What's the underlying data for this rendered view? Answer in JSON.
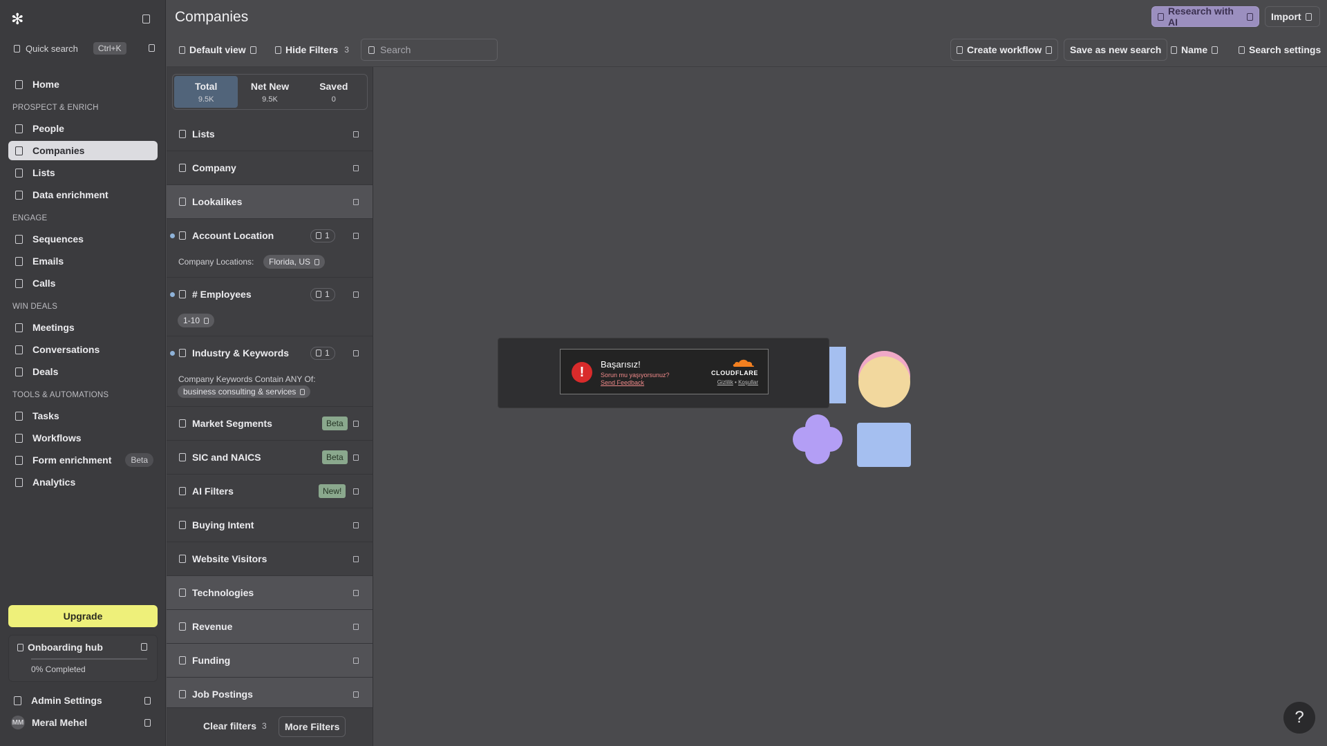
{
  "app": {
    "logo": "✻"
  },
  "sidebar": {
    "quick_search": {
      "label": "Quick search",
      "shortcut": "Ctrl+K"
    },
    "home": "Home",
    "sections": [
      {
        "title": "PROSPECT & ENRICH",
        "items": [
          "People",
          "Companies",
          "Lists",
          "Data enrichment"
        ]
      },
      {
        "title": "ENGAGE",
        "items": [
          "Sequences",
          "Emails",
          "Calls"
        ]
      },
      {
        "title": "WIN DEALS",
        "items": [
          "Meetings",
          "Conversations",
          "Deals"
        ]
      },
      {
        "title": "TOOLS & AUTOMATIONS",
        "items": [
          "Tasks",
          "Workflows",
          "Form enrichment",
          "Analytics"
        ]
      }
    ],
    "active_item": "Companies",
    "form_enrichment_badge": "Beta",
    "upgrade": "Upgrade",
    "onboarding": {
      "title": "Onboarding hub",
      "progress_label": "0% Completed",
      "progress": 0
    },
    "admin_settings": "Admin Settings",
    "user": {
      "initials": "MM",
      "name": "Meral Mehel"
    }
  },
  "header": {
    "title": "Companies",
    "research_ai": "Research with AI",
    "import": "Import"
  },
  "toolbar": {
    "default_view": "Default view",
    "hide_filters": "Hide Filters",
    "hide_filters_count": "3",
    "search_placeholder": "Search",
    "create_workflow": "Create workflow",
    "save_search": "Save as new search",
    "sort_name": "Name",
    "search_settings": "Search settings"
  },
  "tabs": [
    {
      "label": "Total",
      "count": "9.5K"
    },
    {
      "label": "Net New",
      "count": "9.5K"
    },
    {
      "label": "Saved",
      "count": "0"
    }
  ],
  "filters": {
    "lists": "Lists",
    "company": "Company",
    "lookalikes": "Lookalikes",
    "account_location": {
      "label": "Account Location",
      "count": "1",
      "sub_label": "Company Locations:",
      "value": "Florida, US"
    },
    "employees": {
      "label": "# Employees",
      "count": "1",
      "value": "1-10"
    },
    "industry": {
      "label": "Industry & Keywords",
      "count": "1",
      "sub_label": "Company Keywords Contain ANY Of:",
      "value": "business consulting & services"
    },
    "market_segments": {
      "label": "Market Segments",
      "badge": "Beta"
    },
    "sic_naics": {
      "label": "SIC and NAICS",
      "badge": "Beta"
    },
    "ai_filters": {
      "label": "AI Filters",
      "badge": "New!"
    },
    "buying_intent": "Buying Intent",
    "website_visitors": "Website Visitors",
    "technologies": "Technologies",
    "revenue": "Revenue",
    "funding": "Funding",
    "job_postings": "Job Postings",
    "clear_filters": "Clear filters",
    "clear_count": "3",
    "more_filters": "More Filters"
  },
  "cloudflare": {
    "title": "Başarısız!",
    "subtitle": "Sorun mu yaşıyorsunuz?",
    "feedback": "Send Feedback",
    "brand": "CLOUDFLARE",
    "privacy": "Gizlilik",
    "separator": "•",
    "terms": "Koşullar"
  },
  "help": "?",
  "colors": {
    "accent_active_tab": "#51647a",
    "upgrade": "#eef07a",
    "cloudflare_orange": "#f38020",
    "error_red": "#d92b2b"
  }
}
